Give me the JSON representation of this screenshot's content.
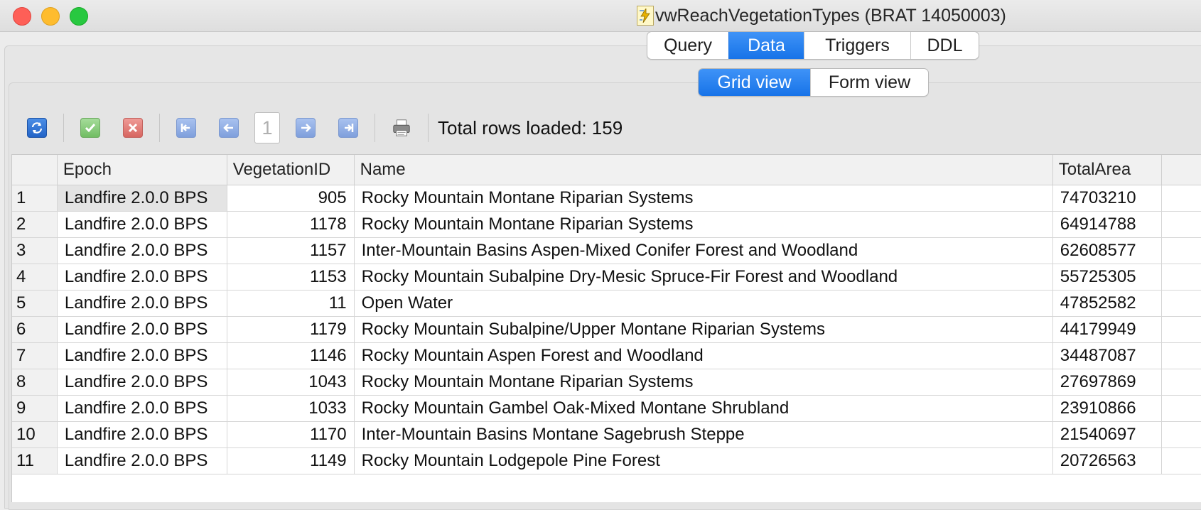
{
  "window": {
    "title": "vwReachVegetationTypes (BRAT 14050003)"
  },
  "tabs": [
    {
      "label": "Query",
      "active": false
    },
    {
      "label": "Data",
      "active": true
    },
    {
      "label": "Triggers",
      "active": false
    },
    {
      "label": "DDL",
      "active": false
    }
  ],
  "views": [
    {
      "label": "Grid view",
      "active": true
    },
    {
      "label": "Form view",
      "active": false
    }
  ],
  "toolbar": {
    "page_number": "1",
    "rows_loaded": "Total rows loaded: 159",
    "icons": [
      "refresh-icon",
      "commit-icon",
      "rollback-icon",
      "first-page-icon",
      "previous-page-icon",
      "next-page-icon",
      "last-page-icon",
      "print-icon"
    ]
  },
  "grid": {
    "columns": [
      "Epoch",
      "VegetationID",
      "Name",
      "TotalArea"
    ],
    "rows": [
      {
        "n": "1",
        "epoch": "Landfire 2.0.0 BPS",
        "vid": "905",
        "name": "Rocky Mountain Montane Riparian Systems",
        "area": "74703210"
      },
      {
        "n": "2",
        "epoch": "Landfire 2.0.0 BPS",
        "vid": "1178",
        "name": "Rocky Mountain Montane Riparian Systems",
        "area": "64914788"
      },
      {
        "n": "3",
        "epoch": "Landfire 2.0.0 BPS",
        "vid": "1157",
        "name": "Inter-Mountain Basins Aspen-Mixed Conifer Forest and Woodland",
        "area": "62608577"
      },
      {
        "n": "4",
        "epoch": "Landfire 2.0.0 BPS",
        "vid": "1153",
        "name": "Rocky Mountain Subalpine Dry-Mesic Spruce-Fir Forest and Woodland",
        "area": "55725305"
      },
      {
        "n": "5",
        "epoch": "Landfire 2.0.0 BPS",
        "vid": "11",
        "name": "Open Water",
        "area": "47852582"
      },
      {
        "n": "6",
        "epoch": "Landfire 2.0.0 BPS",
        "vid": "1179",
        "name": "Rocky Mountain Subalpine/Upper Montane Riparian Systems",
        "area": "44179949"
      },
      {
        "n": "7",
        "epoch": "Landfire 2.0.0 BPS",
        "vid": "1146",
        "name": "Rocky Mountain Aspen Forest and Woodland",
        "area": "34487087"
      },
      {
        "n": "8",
        "epoch": "Landfire 2.0.0 BPS",
        "vid": "1043",
        "name": "Rocky Mountain Montane Riparian Systems",
        "area": "27697869"
      },
      {
        "n": "9",
        "epoch": "Landfire 2.0.0 BPS",
        "vid": "1033",
        "name": "Rocky Mountain Gambel Oak-Mixed Montane Shrubland",
        "area": "23910866"
      },
      {
        "n": "10",
        "epoch": "Landfire 2.0.0 BPS",
        "vid": "1170",
        "name": "Inter-Mountain Basins Montane Sagebrush Steppe",
        "area": "21540697"
      },
      {
        "n": "11",
        "epoch": "Landfire 2.0.0 BPS",
        "vid": "1149",
        "name": "Rocky Mountain Lodgepole Pine Forest",
        "area": "20726563"
      }
    ]
  },
  "colors": {
    "accent": "#1773e8",
    "titlebar": "#e4e4e4"
  }
}
